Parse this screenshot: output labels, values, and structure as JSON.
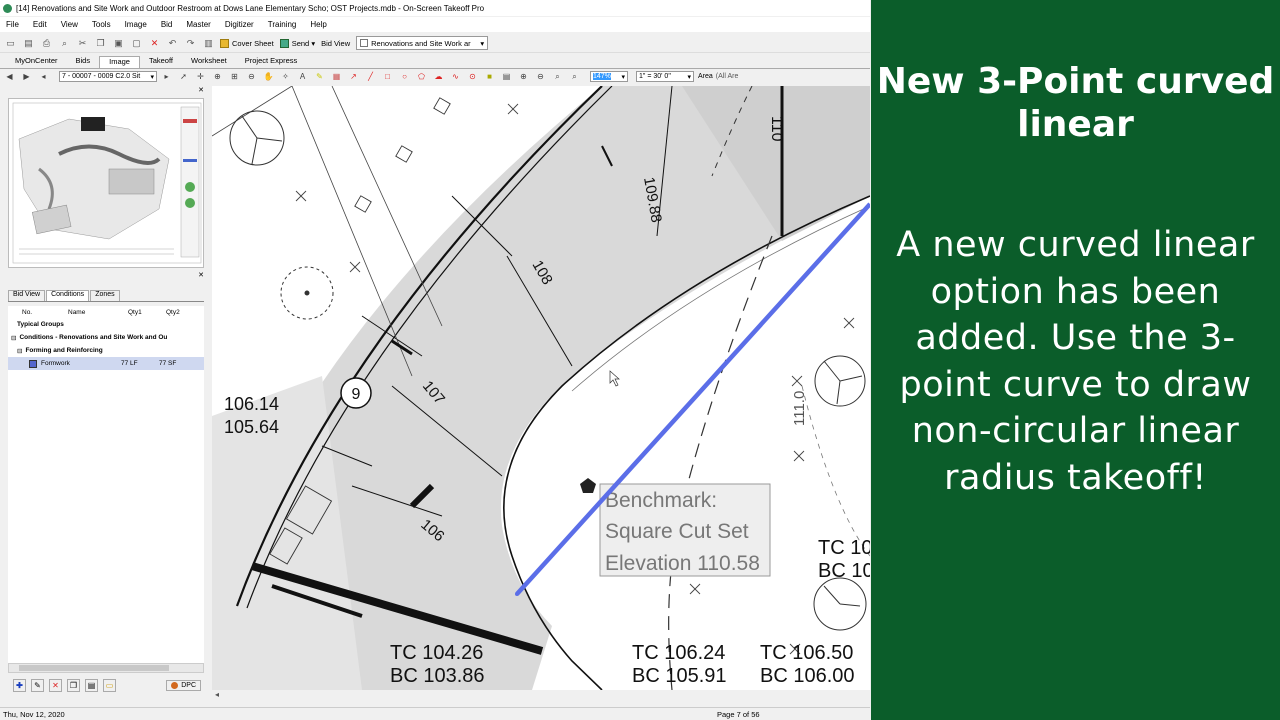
{
  "window": {
    "title": "[14] Renovations and Site Work and Outdoor Restroom at Dows Lane Elementary Scho; OST Projects.mdb - On-Screen Takeoff Pro"
  },
  "menu": [
    "File",
    "Edit",
    "View",
    "Tools",
    "Image",
    "Bid",
    "Master",
    "Digitizer",
    "Training",
    "Help"
  ],
  "toolbar": {
    "cover_sheet": "Cover Sheet",
    "send": "Send",
    "bid_view_label": "Bid View",
    "bid_view_value": "Renovations and Site Work ar"
  },
  "tabs": [
    "MyOnCenter",
    "Bids",
    "Image",
    "Takeoff",
    "Worksheet",
    "Project Express"
  ],
  "active_tab": "Image",
  "image_toolbar": {
    "page_select": "7 - 00007 - 0009 C2.0 Sit",
    "zoom": "147%",
    "scale": "1\" = 30' 0\"",
    "area_label": "Area",
    "area_value": "(All Are"
  },
  "left_panel": {
    "tabs": [
      "Bid View",
      "Conditions",
      "Zones"
    ],
    "active_tab": "Conditions",
    "columns": [
      "No.",
      "Name",
      "Qty1",
      "Qty2"
    ],
    "rows": [
      {
        "text": "Typical Groups",
        "indent": 1,
        "bold": true
      },
      {
        "text": "Conditions - Renovations and Site Work and Ou",
        "indent": 0,
        "bold": true,
        "expander": "⊟"
      },
      {
        "text": "Forming and Reinforcing",
        "indent": 1,
        "bold": true,
        "expander": "⊟"
      },
      {
        "text": "Formwork",
        "indent": 3,
        "qty1": "77 LF",
        "qty2": "77 SF",
        "selected": true,
        "swatch": "#5566cc"
      }
    ],
    "dpc_label": "DPC"
  },
  "drawing": {
    "labels": {
      "a": "106.14",
      "b": "105.64",
      "c": "TC 104.26",
      "d": "BC 103.86",
      "e": "TC 106.24",
      "f": "BC 105.91",
      "g": "TC 106.50",
      "h": "BC 106.00",
      "i": "TC 10",
      "j": "BC 10",
      "k": "9",
      "l": "110",
      "m": "109.88",
      "n": "108",
      "o": "107",
      "p": "106",
      "q": "111.0"
    },
    "benchmark": [
      "Benchmark:",
      "Square Cut Set",
      "Elevation 110.58"
    ]
  },
  "status": {
    "date": "Thu, Nov 12, 2020",
    "page": "Page 7 of 56"
  },
  "promo": {
    "heading": "New 3-Point curved linear",
    "body": "A new curved linear option has been added. Use the 3-point curve to draw non-circular linear radius takeoff!",
    "bg_color": "#0b5d2a"
  }
}
